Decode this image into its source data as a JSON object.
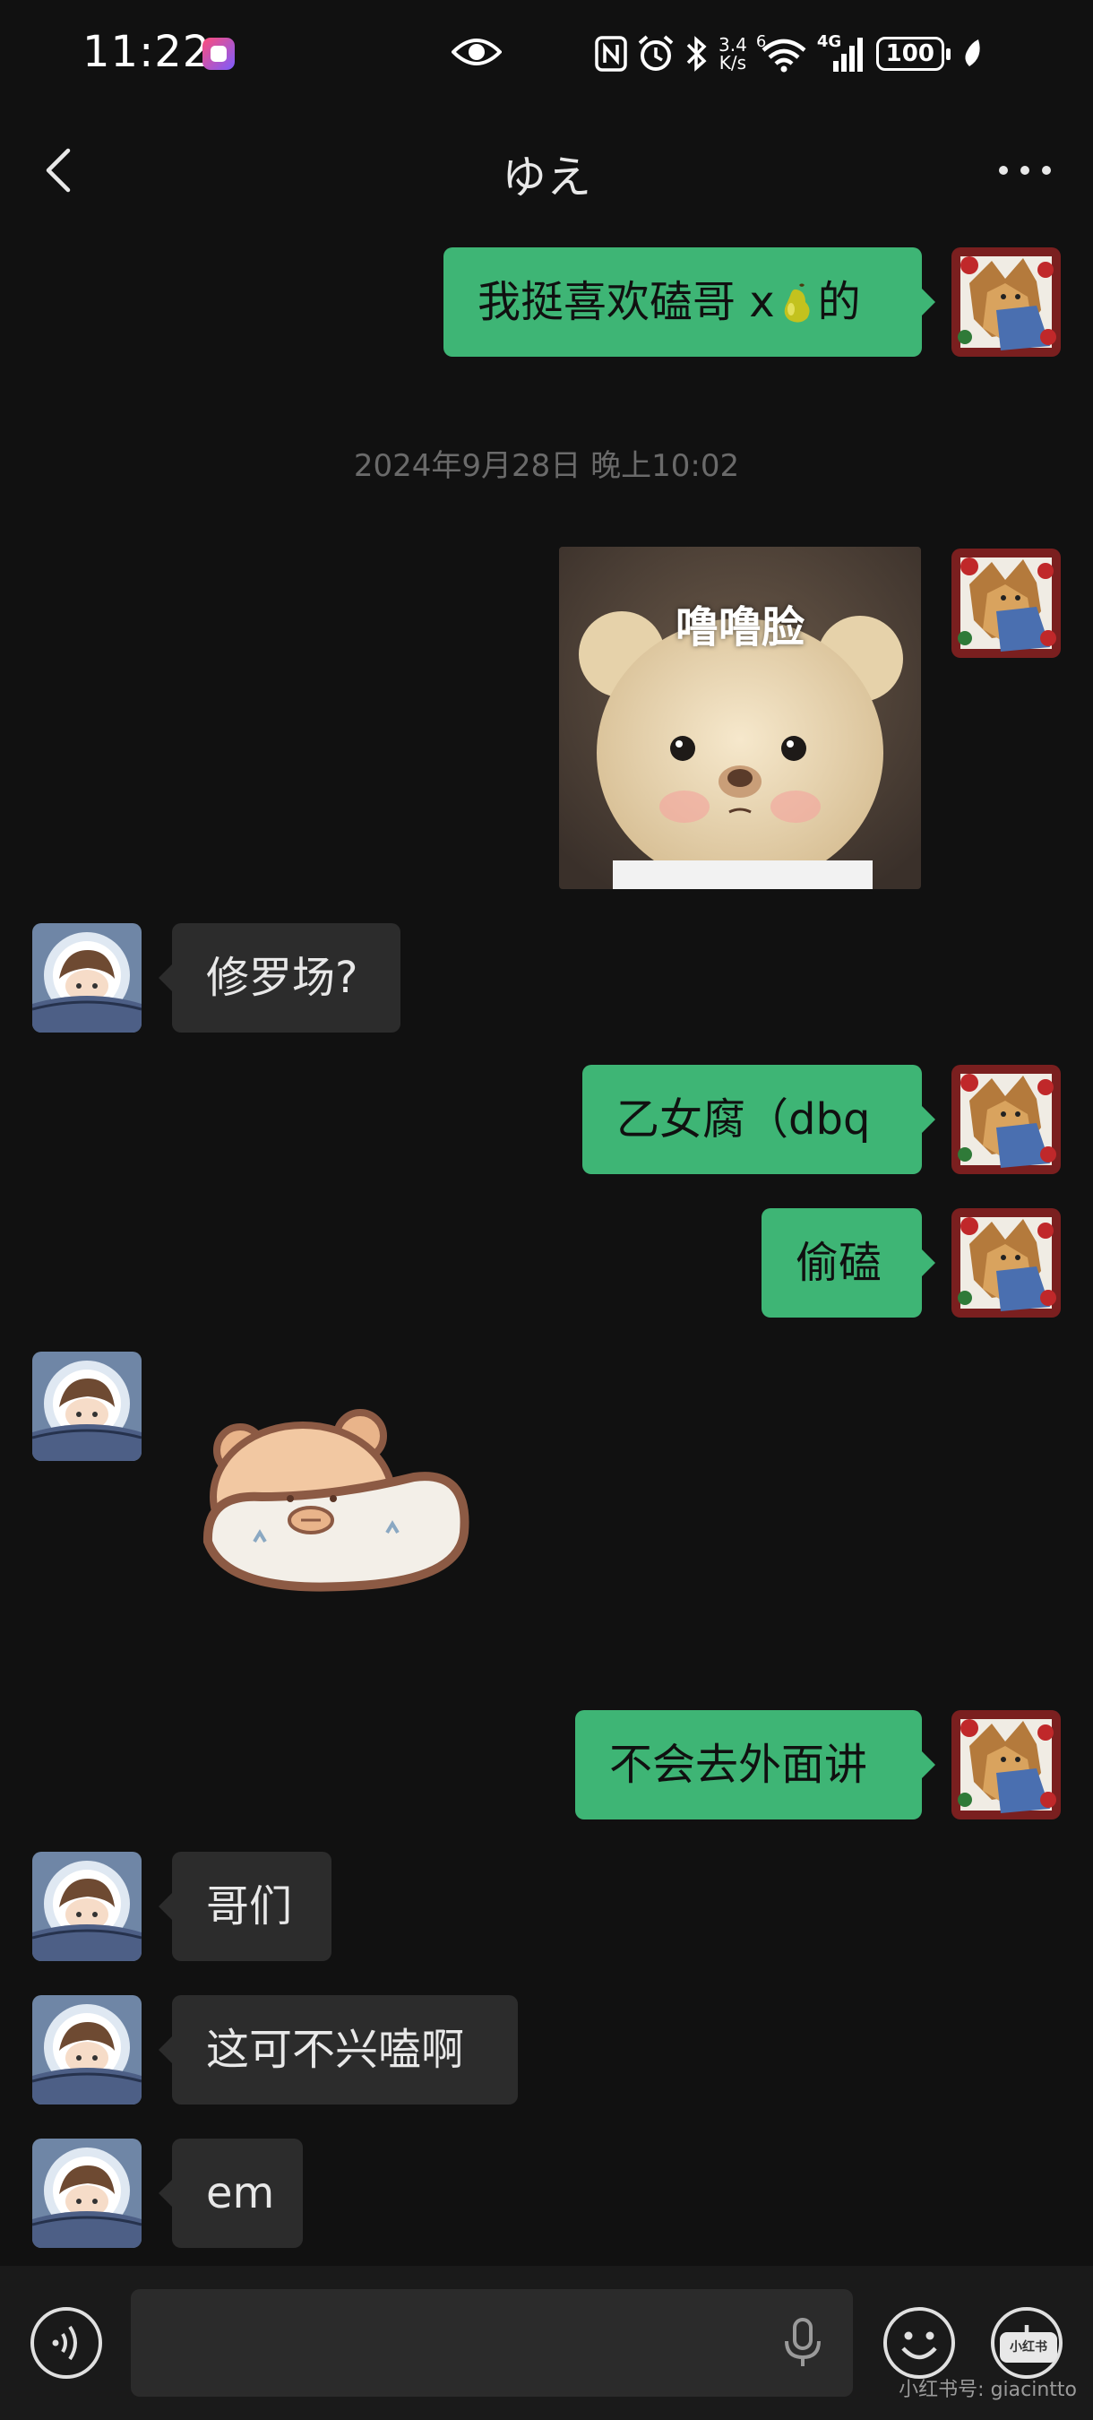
{
  "status_bar": {
    "time": "11:22",
    "network_speed_value": "3.4",
    "network_speed_unit": "K/s",
    "signal_label": "4G",
    "wifi_label": "6",
    "battery": "100",
    "icons": [
      "app-notification-icon",
      "eye-icon",
      "nfc-icon",
      "alarm-icon",
      "bluetooth-icon",
      "wifi-icon",
      "signal-icon",
      "battery-icon",
      "leaf-icon"
    ]
  },
  "header": {
    "title": "ゆえ",
    "back_icon": "chevron-left-icon",
    "more_icon": "more-dots-icon"
  },
  "messages": {
    "m1_prefix": "我挺喜欢磕哥 x",
    "m1_suffix": "的",
    "timestamp": "2024年9月28日 晚上10:02",
    "sticker1_caption": "噜噜脸",
    "m3": "修罗场?",
    "m4": "乙女腐（dbq",
    "m5": "偷磕",
    "m7": "不会去外面讲",
    "m8": "哥们",
    "m9": "这可不兴嗑啊",
    "m10": "em"
  },
  "input_bar": {
    "placeholder": "",
    "icons": [
      "voice-icon",
      "microphone-icon",
      "emoji-icon",
      "plus-icon"
    ]
  },
  "watermark": {
    "badge": "小红书",
    "text": "小红书号: giacintto"
  },
  "colors": {
    "background": "#111111",
    "my_bubble": "#3eb575",
    "other_bubble": "#2c2c2c",
    "timestamp": "#6a6a6a"
  }
}
